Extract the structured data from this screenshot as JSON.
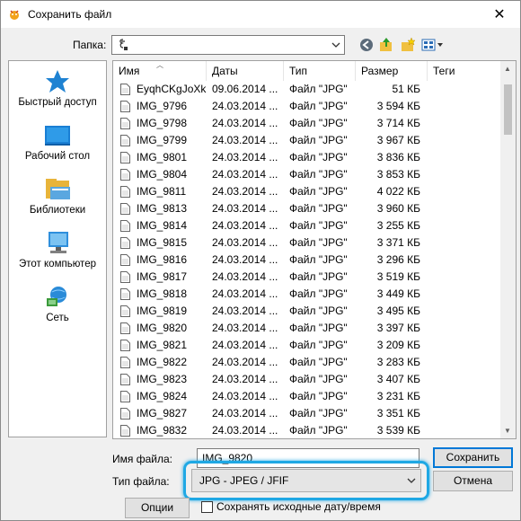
{
  "window": {
    "title": "Сохранить файл",
    "close_glyph": "✕"
  },
  "folder": {
    "label": "Папка:",
    "value": ""
  },
  "toolbar": {
    "icons": [
      "back-icon",
      "up-folder-icon",
      "new-folder-icon",
      "view-menu-icon"
    ]
  },
  "places": [
    {
      "label": "Быстрый доступ",
      "icon": "star-icon"
    },
    {
      "label": "Рабочий стол",
      "icon": "desktop-icon"
    },
    {
      "label": "Библиотеки",
      "icon": "libraries-icon"
    },
    {
      "label": "Этот компьютер",
      "icon": "computer-icon"
    },
    {
      "label": "Сеть",
      "icon": "network-icon"
    }
  ],
  "columns": {
    "name": "Имя",
    "date": "Даты",
    "type": "Тип",
    "size": "Размер",
    "tags": "Теги"
  },
  "files": [
    {
      "name": "EyqhCKgJoXk",
      "date": "09.06.2014 ...",
      "type": "Файл \"JPG\"",
      "size": "51 КБ"
    },
    {
      "name": "IMG_9796",
      "date": "24.03.2014 ...",
      "type": "Файл \"JPG\"",
      "size": "3 594 КБ"
    },
    {
      "name": "IMG_9798",
      "date": "24.03.2014 ...",
      "type": "Файл \"JPG\"",
      "size": "3 714 КБ"
    },
    {
      "name": "IMG_9799",
      "date": "24.03.2014 ...",
      "type": "Файл \"JPG\"",
      "size": "3 967 КБ"
    },
    {
      "name": "IMG_9801",
      "date": "24.03.2014 ...",
      "type": "Файл \"JPG\"",
      "size": "3 836 КБ"
    },
    {
      "name": "IMG_9804",
      "date": "24.03.2014 ...",
      "type": "Файл \"JPG\"",
      "size": "3 853 КБ"
    },
    {
      "name": "IMG_9811",
      "date": "24.03.2014 ...",
      "type": "Файл \"JPG\"",
      "size": "4 022 КБ"
    },
    {
      "name": "IMG_9813",
      "date": "24.03.2014 ...",
      "type": "Файл \"JPG\"",
      "size": "3 960 КБ"
    },
    {
      "name": "IMG_9814",
      "date": "24.03.2014 ...",
      "type": "Файл \"JPG\"",
      "size": "3 255 КБ"
    },
    {
      "name": "IMG_9815",
      "date": "24.03.2014 ...",
      "type": "Файл \"JPG\"",
      "size": "3 371 КБ"
    },
    {
      "name": "IMG_9816",
      "date": "24.03.2014 ...",
      "type": "Файл \"JPG\"",
      "size": "3 296 КБ"
    },
    {
      "name": "IMG_9817",
      "date": "24.03.2014 ...",
      "type": "Файл \"JPG\"",
      "size": "3 519 КБ"
    },
    {
      "name": "IMG_9818",
      "date": "24.03.2014 ...",
      "type": "Файл \"JPG\"",
      "size": "3 449 КБ"
    },
    {
      "name": "IMG_9819",
      "date": "24.03.2014 ...",
      "type": "Файл \"JPG\"",
      "size": "3 495 КБ"
    },
    {
      "name": "IMG_9820",
      "date": "24.03.2014 ...",
      "type": "Файл \"JPG\"",
      "size": "3 397 КБ"
    },
    {
      "name": "IMG_9821",
      "date": "24.03.2014 ...",
      "type": "Файл \"JPG\"",
      "size": "3 209 КБ"
    },
    {
      "name": "IMG_9822",
      "date": "24.03.2014 ...",
      "type": "Файл \"JPG\"",
      "size": "3 283 КБ"
    },
    {
      "name": "IMG_9823",
      "date": "24.03.2014 ...",
      "type": "Файл \"JPG\"",
      "size": "3 407 КБ"
    },
    {
      "name": "IMG_9824",
      "date": "24.03.2014 ...",
      "type": "Файл \"JPG\"",
      "size": "3 231 КБ"
    },
    {
      "name": "IMG_9827",
      "date": "24.03.2014 ...",
      "type": "Файл \"JPG\"",
      "size": "3 351 КБ"
    },
    {
      "name": "IMG_9832",
      "date": "24.03.2014 ...",
      "type": "Файл \"JPG\"",
      "size": "3 539 КБ"
    }
  ],
  "form": {
    "filename_label": "Имя файла:",
    "filename_value": "IMG_9820",
    "filetype_label": "Тип файла:",
    "filetype_value": "JPG - JPEG / JFIF",
    "save_label": "Сохранить",
    "cancel_label": "Отмена",
    "options_label": "Опции",
    "keep_date_label": "Сохранять исходные дату/время",
    "keep_date_checked": false
  },
  "colors": {
    "highlight": "#1fa8e4",
    "primary_border": "#0078d7"
  }
}
